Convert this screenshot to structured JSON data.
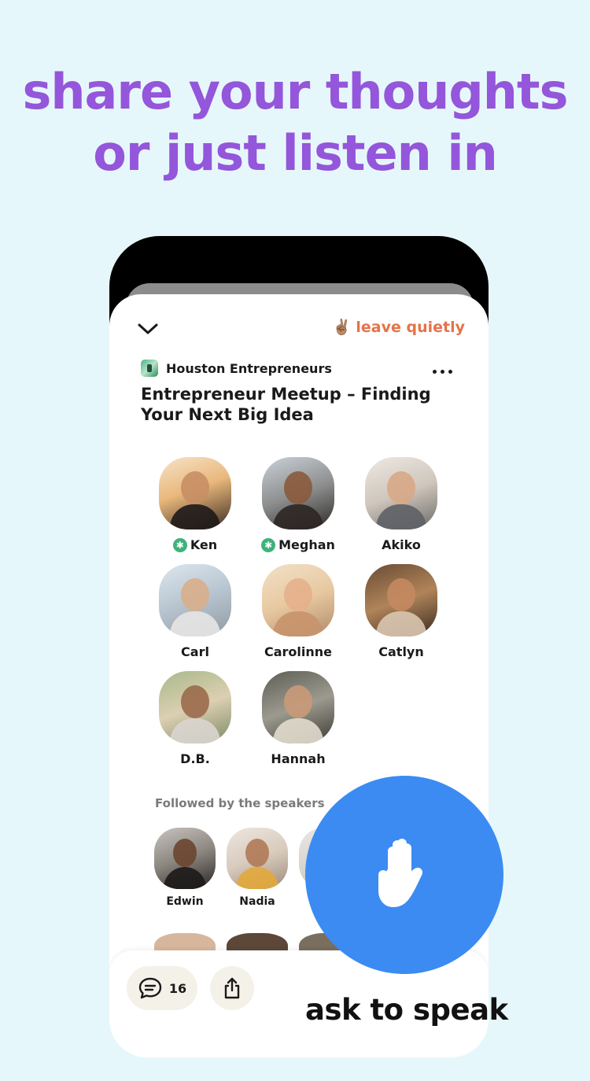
{
  "headline": {
    "line1": "share your thoughts",
    "line2": "or just listen in"
  },
  "room": {
    "leave_label": "leave quietly",
    "leave_emoji": "✌🏽",
    "club_name": "Houston Entrepreneurs",
    "title": "Entrepreneur Meetup – Finding Your Next Big Idea"
  },
  "speakers": [
    {
      "name": "Ken",
      "moderator": true
    },
    {
      "name": "Meghan",
      "moderator": true
    },
    {
      "name": "Akiko",
      "moderator": false
    },
    {
      "name": "Carl",
      "moderator": false
    },
    {
      "name": "Carolinne",
      "moderator": false
    },
    {
      "name": "Catlyn",
      "moderator": false
    },
    {
      "name": "D.B.",
      "moderator": false
    },
    {
      "name": "Hannah",
      "moderator": false
    }
  ],
  "followed": {
    "label": "Followed by the speakers",
    "listeners": [
      {
        "name": "Edwin"
      },
      {
        "name": "Nadia"
      }
    ]
  },
  "bottom_bar": {
    "chat_count": "16"
  },
  "cta": {
    "label": "ask to speak"
  },
  "colors": {
    "background": "#E6F7FC",
    "headline": "#9456DA",
    "leave": "#E5734A",
    "moderator_badge": "#3EB27A",
    "hand_button": "#3B8BF2"
  },
  "icons": {
    "back": "chevron-down-icon",
    "more": "more-dots-icon",
    "chat": "chat-bubble-icon",
    "share": "share-icon",
    "hand": "raise-hand-icon"
  }
}
